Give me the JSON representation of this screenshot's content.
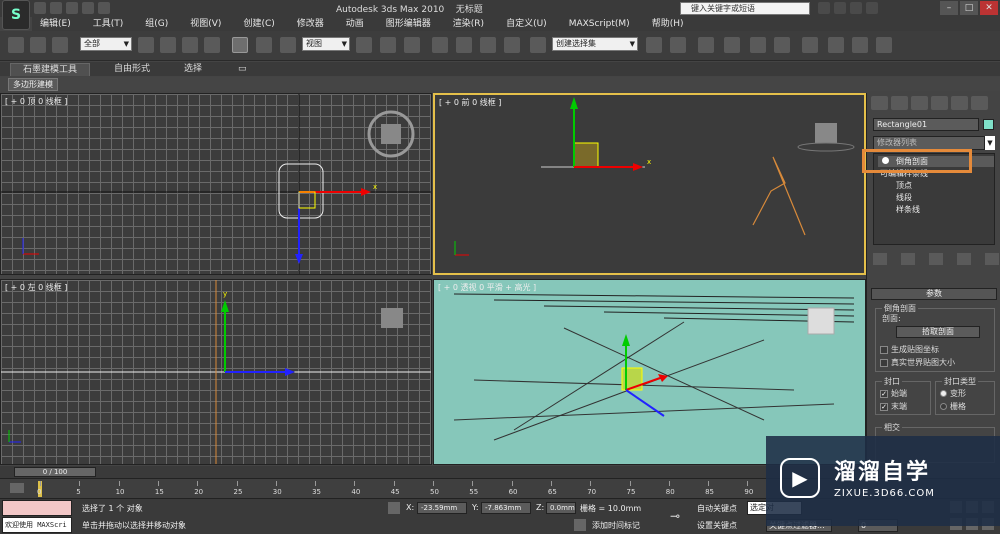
{
  "titlebar": {
    "app_title": "Autodesk 3ds Max  2010",
    "doc_title": "无标题",
    "search_placeholder": "键入关键字或短语"
  },
  "menubar": [
    "编辑(E)",
    "工具(T)",
    "组(G)",
    "视图(V)",
    "创建(C)",
    "修改器",
    "动画",
    "图形编辑器",
    "渲染(R)",
    "自定义(U)",
    "MAXScript(M)",
    "帮助(H)"
  ],
  "toolbar": {
    "selection_filter": "全部",
    "reference_coord": "视图",
    "named_selection": "创建选择集"
  },
  "ribbon": {
    "tabs": [
      "石墨建模工具",
      "自由形式",
      "选择"
    ],
    "active_tab": "石墨建模工具",
    "sub_tab": "多边形建模"
  },
  "viewports": {
    "top": "[ + 0 顶 0 线框 ]",
    "front": "[ + 0 前 0 线框 ]",
    "left": "[ + 0 左 0 线框 ]",
    "perspective": "[ + 0 透视 0 平滑 + 高光 ]"
  },
  "command_panel": {
    "object_name": "Rectangle01",
    "modifier_list": "修改器列表",
    "stack": [
      "倒角剖面",
      "可编辑样条线",
      "顶点",
      "线段",
      "样条线"
    ],
    "selected_modifier": "倒角剖面",
    "rollout_title": "参数",
    "group_bevel_profile": "倒角剖面",
    "profile_label": "剖面:",
    "pick_profile_button": "拾取剖面",
    "gen_map_coords": "生成贴图坐标",
    "real_world_map": "真实世界贴图大小",
    "cap_group": "封口",
    "cap_start": "始端",
    "cap_end": "末端",
    "cap_type_group": "封口类型",
    "cap_morph": "变形",
    "cap_grid": "栅格",
    "intersect_group": "相交"
  },
  "timeline": {
    "slider": "0 / 100",
    "ticks": [
      "0",
      "5",
      "10",
      "15",
      "20",
      "25",
      "30",
      "35",
      "40",
      "45",
      "50",
      "55",
      "60",
      "65",
      "70",
      "75",
      "80",
      "85",
      "90"
    ]
  },
  "statusbar": {
    "maxscript_text": "欢迎使用 MAXScri",
    "selected_count": "选择了 1 个 对象",
    "prompt": "单击并拖动以选择并移动对象",
    "x_label": "X:",
    "x_value": "-23.59mm",
    "y_label": "Y:",
    "y_value": "-7.863mm",
    "z_label": "Z:",
    "z_value": "0.0mm",
    "grid": "栅格 = 10.0mm",
    "add_time_tag": "添加时间标记",
    "auto_key": "自动关键点",
    "set_key": "设置关键点",
    "selection_dd": "选定对",
    "key_filter": "关键点过滤器...",
    "frame": "0"
  },
  "watermark": {
    "brand_cn": "溜溜自学",
    "brand_en": "ZIXUE.3D66.COM"
  },
  "colors": {
    "highlight": "#e58a3a",
    "perspective_bg": "#86c7ba",
    "object_color": "#7fe0c8"
  }
}
